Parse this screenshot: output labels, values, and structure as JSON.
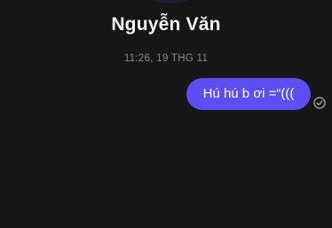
{
  "conversation": {
    "contact_name": "Nguyễn Văn",
    "timestamp": "11:26, 19 THG 11"
  },
  "messages": [
    {
      "direction": "outgoing",
      "text": "Hú hú b ơi =“(((",
      "status_icon": "check-circle-icon"
    }
  ],
  "colors": {
    "background": "#161616",
    "outgoing_bubble": "#5b4ff2",
    "timestamp_text": "#8b8b8b",
    "status_icon": "#9a9a9a"
  }
}
